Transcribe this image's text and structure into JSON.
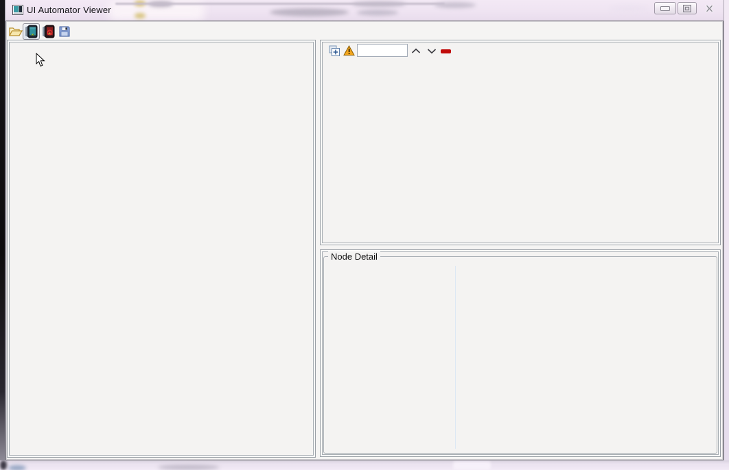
{
  "window": {
    "title": "UI Automator Viewer",
    "app_icon": "app-window-icon",
    "controls": [
      {
        "name": "minimize-button",
        "icon": "minimize-icon"
      },
      {
        "name": "maximize-button",
        "icon": "maximize-icon"
      },
      {
        "name": "close-button",
        "icon": "close-icon"
      }
    ]
  },
  "main_toolbar": {
    "buttons": [
      {
        "name": "open-button",
        "icon": "open-folder-icon",
        "state": "normal"
      },
      {
        "name": "device-screenshot-button",
        "icon": "device-screenshot-icon",
        "state": "hovered"
      },
      {
        "name": "device-screenshot-compressed-button",
        "icon": "device-screenshot-compressed-icon",
        "state": "normal"
      },
      {
        "name": "save-button",
        "icon": "save-floppy-icon",
        "state": "normal"
      }
    ]
  },
  "screenshot_panel": {
    "content": ""
  },
  "tree_panel": {
    "toolbar": {
      "expand_all_icon": "expand-all-icon",
      "toggle_naf_icon": "warning-triangle-icon",
      "search": {
        "value": "",
        "placeholder": ""
      },
      "previous_icon": "chevron-up-icon",
      "next_icon": "chevron-down-icon",
      "clear_icon": "red-minus-icon"
    },
    "tree_items": []
  },
  "node_detail_panel": {
    "label": "Node Detail",
    "rows": []
  },
  "cursor": {
    "icon": "arrow-cursor"
  },
  "colors": {
    "titlebar_glass": "#f0e5f2",
    "frame_dark_edge": "#0d0c0e",
    "client_bg": "#f5f4f3",
    "panel_border": "#9aa0a6",
    "warning_orange": "#f2a51d",
    "clear_red": "#c00a0a",
    "screen_teal": "#2e8f9c",
    "android_green": "#a4c639",
    "save_blue": "#8fa8dc",
    "compressed_red": "#8a1f1f"
  }
}
